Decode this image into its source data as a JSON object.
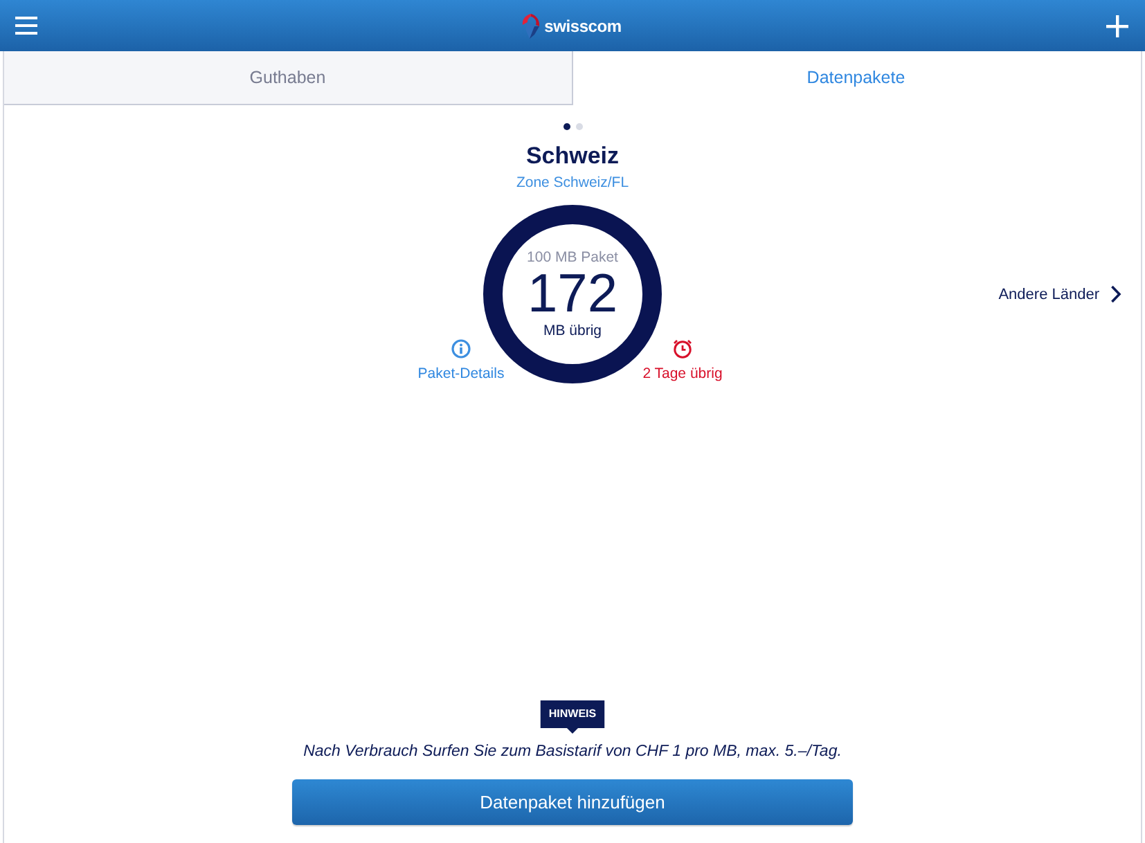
{
  "header": {
    "brand": "swisscom"
  },
  "tabs": [
    {
      "label": "Guthaben",
      "selected": false
    },
    {
      "label": "Datenpakete",
      "selected": true
    }
  ],
  "pager": [
    {
      "selected": true
    },
    {
      "selected": false
    }
  ],
  "package": {
    "title": "Schweiz",
    "zone": "Zone Schweiz/FL",
    "name": "100 MB Paket",
    "amount": "172",
    "unit": "MB übrig",
    "details_link": "Paket-Details",
    "expiry": "2 Tage übrig"
  },
  "other_countries": "Andere Länder",
  "notice": {
    "badge": "HINWEIS",
    "text": "Nach Verbrauch Surfen Sie zum Basistarif von CHF 1 pro MB, max. 5.–/Tag."
  },
  "primary_button": "Datenpaket hinzufügen"
}
